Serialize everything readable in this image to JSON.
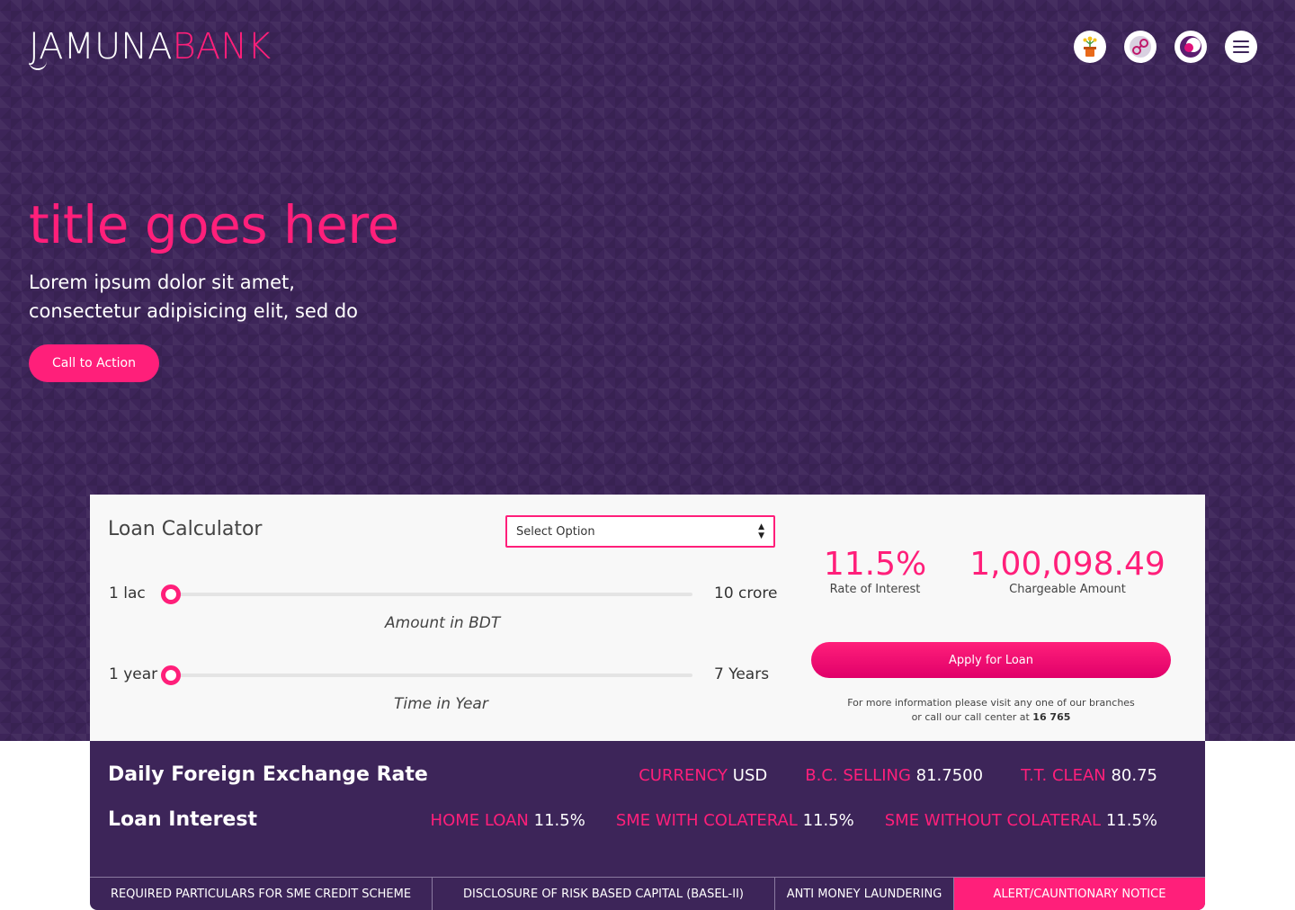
{
  "header": {
    "logo_part1": "JAMUNA",
    "logo_part2": "BANK",
    "icons": [
      "flower-pot-icon",
      "link-icon",
      "moon-icon",
      "menu-icon"
    ]
  },
  "hero": {
    "title": "title goes here",
    "subtitle": "Lorem ipsum dolor sit amet, consectetur adipisicing elit, sed do",
    "cta_label": "Call to Action"
  },
  "calculator": {
    "title": "Loan Calculator",
    "select_value": "Select Option",
    "amount_slider": {
      "min_label": "1 lac",
      "max_label": "10 crore",
      "caption": "Amount in BDT",
      "level": 0
    },
    "time_slider": {
      "min_label": "1 year",
      "max_label": "7 Years",
      "caption": "Time in Year",
      "level": 0
    },
    "rate_value": "11.5%",
    "rate_label": "Rate of Interest",
    "amount_value": "1,00,098.49",
    "amount_label": "Chargeable Amount",
    "apply_label": "Apply for Loan",
    "info_line1": "For more information please visit any one of our branches",
    "info_line2_prefix": "or call our call center at",
    "info_phone": "16 765"
  },
  "exchange": {
    "title": "Daily Foreign Exchange Rate",
    "items": [
      {
        "key": "CURRENCY",
        "value": "USD"
      },
      {
        "key": "B.C. SELLING",
        "value": "81.7500"
      },
      {
        "key": "T.T. CLEAN",
        "value": "80.75"
      }
    ]
  },
  "loan_interest": {
    "title": "Loan Interest",
    "items": [
      {
        "key": "HOME LOAN",
        "value": "11.5%"
      },
      {
        "key": "SME WITH COLATERAL",
        "value": "11.5%"
      },
      {
        "key": "SME WITHOUT COLATERAL",
        "value": "11.5%"
      }
    ]
  },
  "tabs": [
    "REQUIRED PARTICULARS FOR SME CREDIT SCHEME",
    "DISCLOSURE OF RISK BASED CAPITAL (BASEL-II)",
    "ANTI MONEY LAUNDERING",
    "ALERT/CAUNTIONARY NOTICE"
  ],
  "colors": {
    "accent": "#ff1f7a",
    "brand": "#3d2559",
    "panel": "#f8f8f8"
  }
}
